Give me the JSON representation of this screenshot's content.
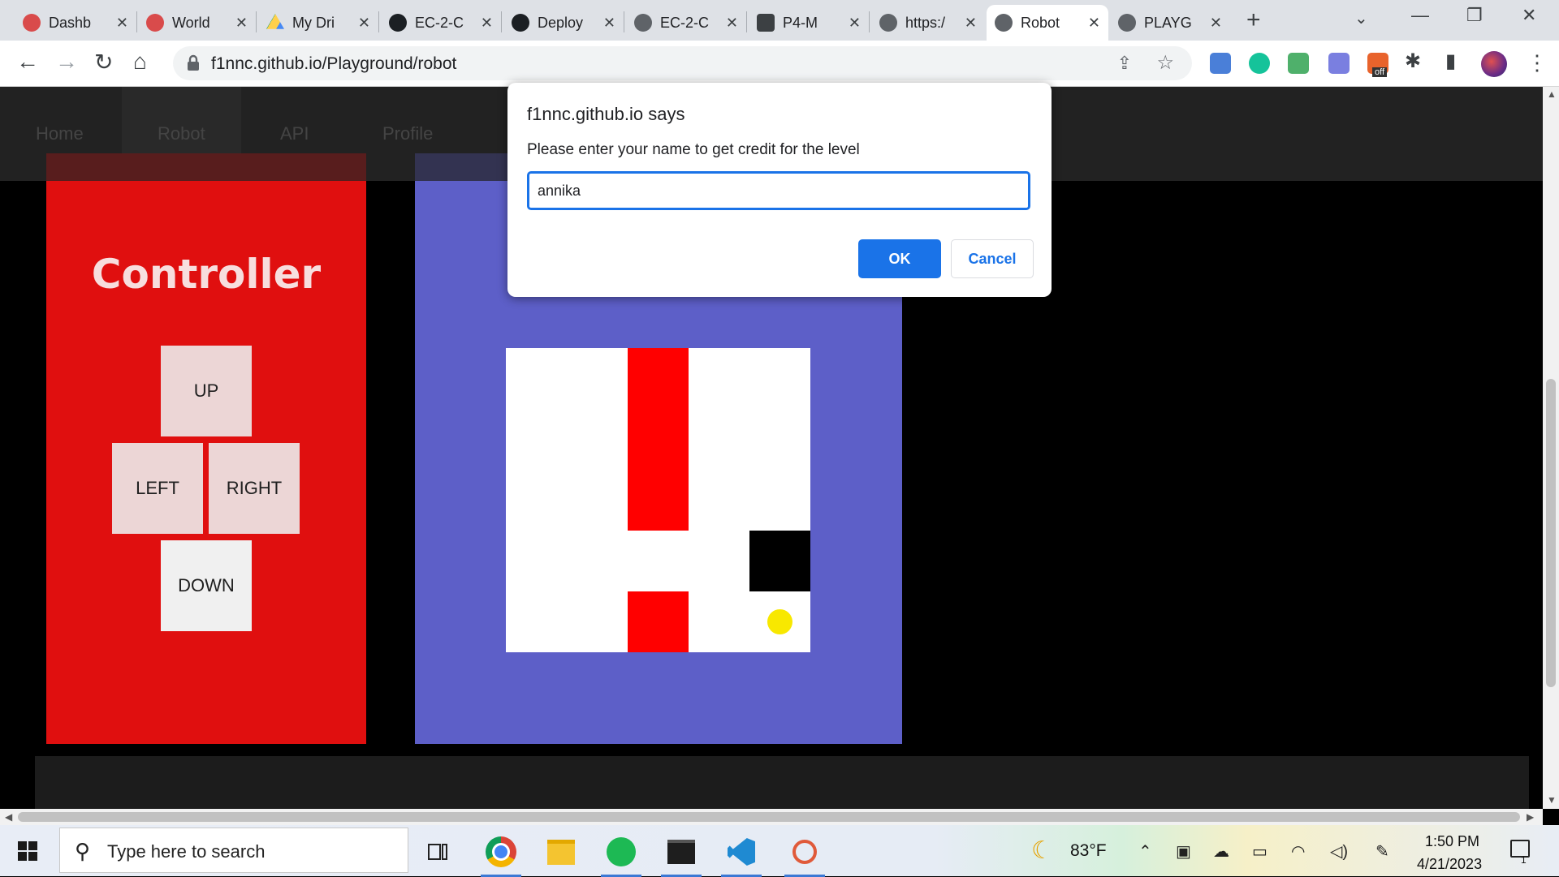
{
  "browser": {
    "tabs": [
      {
        "title": "Dashb",
        "icon": "gear-logo-icon",
        "active": false
      },
      {
        "title": "World",
        "icon": "gear-logo-icon",
        "active": false
      },
      {
        "title": "My Dri",
        "icon": "google-drive-icon",
        "active": false
      },
      {
        "title": "EC-2-C",
        "icon": "github-icon",
        "active": false
      },
      {
        "title": "Deploy",
        "icon": "github-icon",
        "active": false
      },
      {
        "title": "EC-2-C",
        "icon": "globe-icon",
        "active": false
      },
      {
        "title": "P4-M",
        "icon": "tool-icon",
        "active": false
      },
      {
        "title": "https:/",
        "icon": "globe-icon",
        "active": false
      },
      {
        "title": "Robot",
        "icon": "globe-icon",
        "active": true
      },
      {
        "title": "PLAYG",
        "icon": "globe-icon",
        "active": false
      }
    ],
    "url": "f1nnc.github.io/Playground/robot",
    "extension_off_label": "off"
  },
  "site": {
    "nav": [
      "Home",
      "Robot",
      "API",
      "Profile"
    ],
    "active_nav": "Robot",
    "controller": {
      "title": "Controller",
      "up": "UP",
      "left": "LEFT",
      "right": "RIGHT",
      "down": "DOWN"
    },
    "grid": {
      "rows": 5,
      "cols": 5,
      "robot": {
        "row": 4,
        "col": 4,
        "color": "#f8e800"
      },
      "red_walls": [
        [
          0,
          2
        ],
        [
          1,
          2
        ],
        [
          2,
          2
        ],
        [
          4,
          2
        ]
      ],
      "black_goal": [
        [
          3,
          4
        ]
      ]
    }
  },
  "dialog": {
    "title": "f1nnc.github.io says",
    "message": "Please enter your name to get credit for the level",
    "input_value": "annika",
    "ok_label": "OK",
    "cancel_label": "Cancel"
  },
  "taskbar": {
    "search_placeholder": "Type here to search",
    "apps": [
      "chrome",
      "file-explorer",
      "spotify",
      "terminal",
      "vscode",
      "snipping-tool"
    ],
    "weather_temp": "83°F",
    "time": "1:50 PM",
    "date": "4/21/2023",
    "notification_count": "1"
  },
  "colors": {
    "controller_bg": "#e00f0f",
    "game_bg": "#5d5fc8",
    "wall": "#ff0000",
    "ok_button": "#1a73e8"
  }
}
